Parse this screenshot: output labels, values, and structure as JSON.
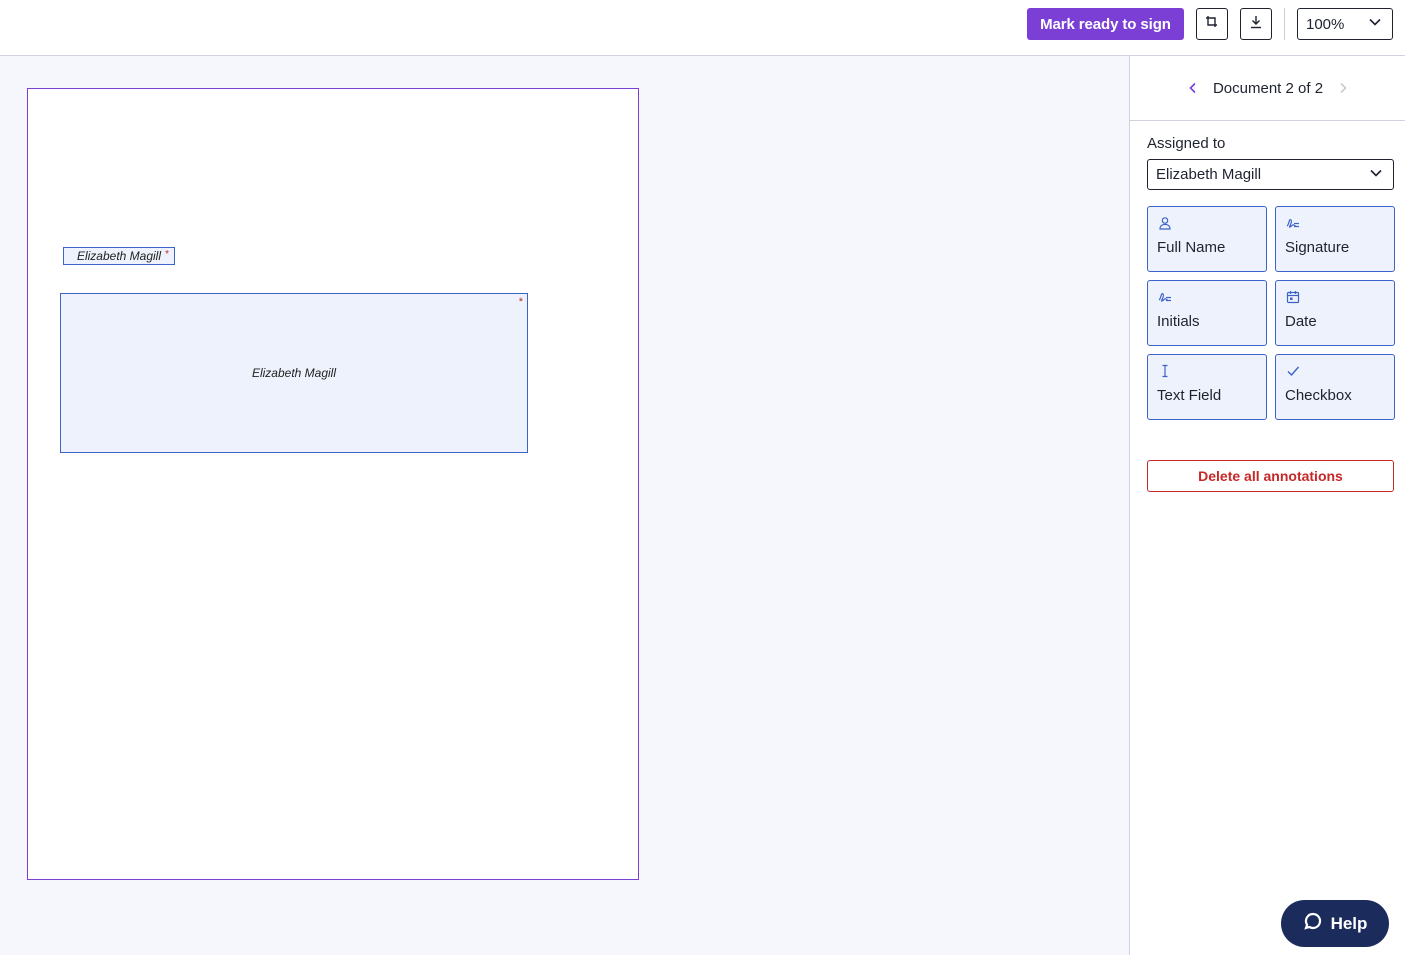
{
  "toolbar": {
    "mark_ready_label": "Mark ready to sign",
    "crop_icon": "crop-icon",
    "download_icon": "download-icon",
    "zoom_value": "100%"
  },
  "document": {
    "annotations": [
      {
        "text": "Elizabeth Magill",
        "required_marker": "*"
      },
      {
        "text": "Elizabeth Magill",
        "required_marker": "*"
      }
    ]
  },
  "panel": {
    "doc_nav_label": "Document 2 of 2",
    "assigned_label": "Assigned to",
    "assigned_value": "Elizabeth Magill",
    "tools": [
      {
        "label": "Full Name",
        "icon": "person-icon"
      },
      {
        "label": "Signature",
        "icon": "signature-icon"
      },
      {
        "label": "Initials",
        "icon": "initials-icon"
      },
      {
        "label": "Date",
        "icon": "calendar-icon"
      },
      {
        "label": "Text Field",
        "icon": "text-cursor-icon"
      },
      {
        "label": "Checkbox",
        "icon": "check-icon"
      }
    ],
    "delete_label": "Delete all annotations"
  },
  "help": {
    "label": "Help"
  },
  "colors": {
    "accent": "#7b3fd6",
    "field_border": "#3c63c9",
    "field_bg": "#edf2fc",
    "danger": "#c62828",
    "help_bg": "#1a2b5c"
  }
}
